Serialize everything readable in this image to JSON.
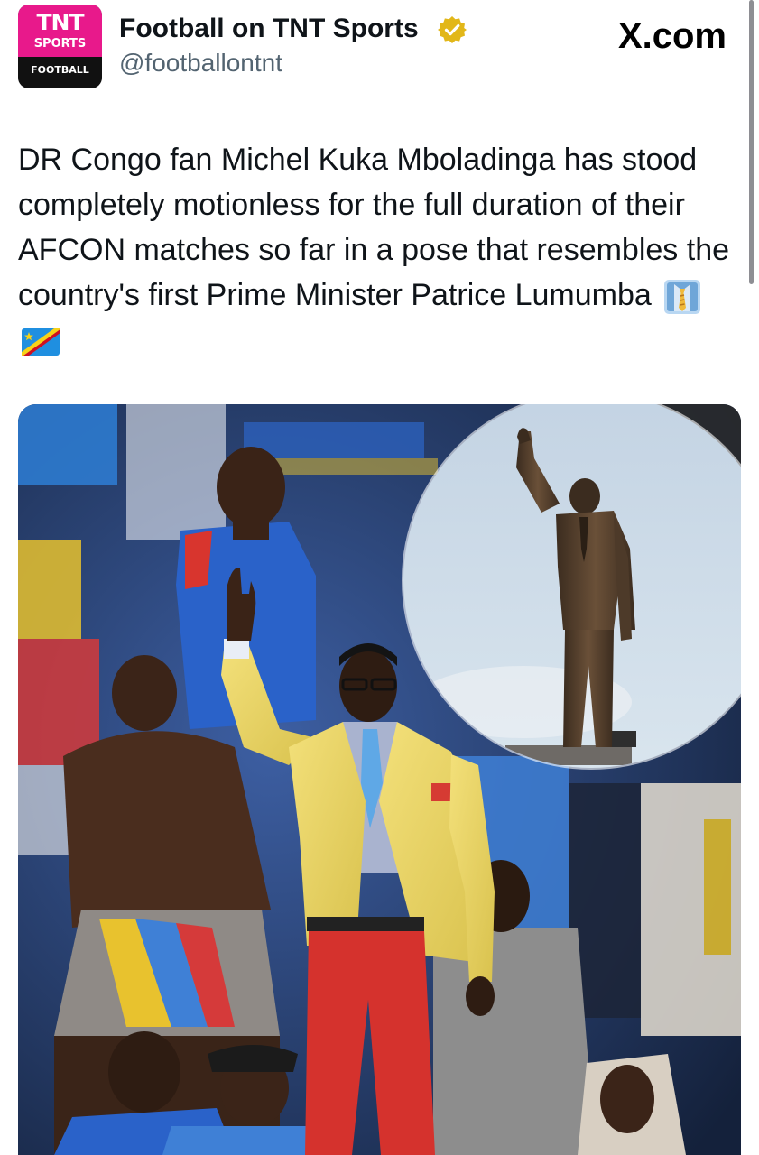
{
  "account": {
    "display_name": "Football on TNT Sports",
    "handle": "@footballontnt",
    "verified": true,
    "avatar": {
      "line1": "TNT",
      "line2": "SPORTS",
      "line3": "FOOTBALL",
      "brand_color": "#e8198b"
    }
  },
  "site_label": "X.com",
  "tweet": {
    "text": "DR Congo fan Michel Kuka Mboladinga has stood completely motionless for the full duration of their AFCON matches so far in a pose that resembles the country's first Prime Minister Patrice Lumumba",
    "emojis": [
      "necktie-shirt-emoji",
      "dr-congo-flag-emoji"
    ]
  },
  "colors": {
    "text_primary": "#0f1419",
    "text_secondary": "#536471",
    "verified_gold": "#e2b719"
  }
}
